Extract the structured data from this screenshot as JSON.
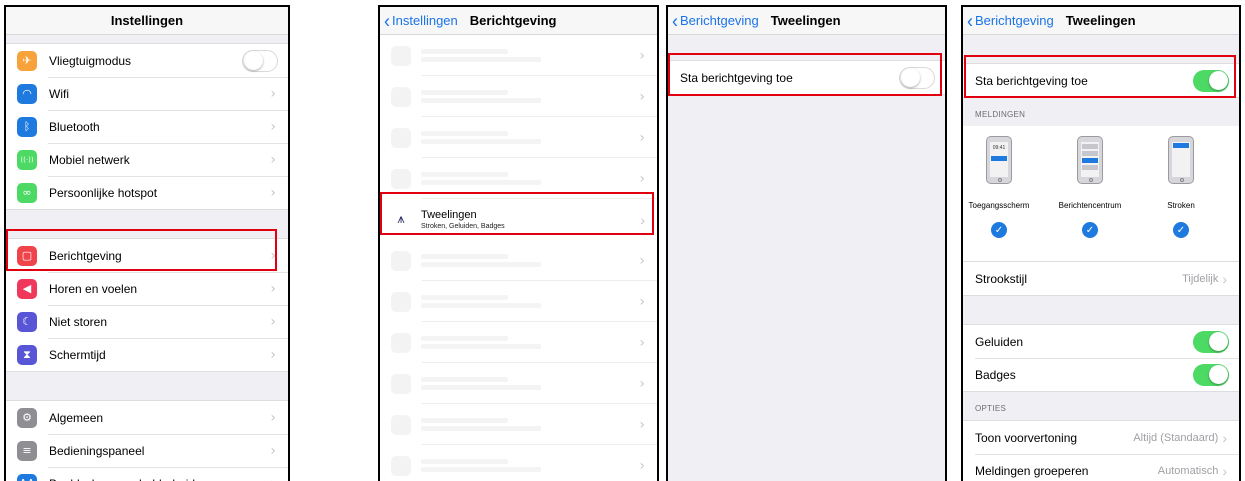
{
  "panel1": {
    "title": "Instellingen",
    "group1": [
      {
        "label": "Vliegtuigmodus",
        "icon": "airplane-icon",
        "color": "#f7a23b",
        "glyph": "✈",
        "control": "toggle-off"
      },
      {
        "label": "Wifi",
        "icon": "wifi-icon",
        "color": "#1f7ae0",
        "glyph": "◠"
      },
      {
        "label": "Bluetooth",
        "icon": "bluetooth-icon",
        "color": "#1f7ae0",
        "glyph": "ᛒ"
      },
      {
        "label": "Mobiel netwerk",
        "icon": "cellular-icon",
        "color": "#4cd964",
        "glyph": "((·))"
      },
      {
        "label": "Persoonlijke hotspot",
        "icon": "hotspot-icon",
        "color": "#4cd964",
        "glyph": "∞"
      }
    ],
    "group2": [
      {
        "label": "Berichtgeving",
        "icon": "notifications-icon",
        "color": "#f0444b",
        "glyph": "▢"
      },
      {
        "label": "Horen en voelen",
        "icon": "sounds-icon",
        "color": "#f0375c",
        "glyph": "◀"
      },
      {
        "label": "Niet storen",
        "icon": "moon-icon",
        "color": "#5856d6",
        "glyph": "☾"
      },
      {
        "label": "Schermtijd",
        "icon": "hourglass-icon",
        "color": "#5856d6",
        "glyph": "⧗"
      }
    ],
    "group3": [
      {
        "label": "Algemeen",
        "icon": "gear-icon",
        "color": "#8e8e93",
        "glyph": "⚙"
      },
      {
        "label": "Bedieningspaneel",
        "icon": "control-center-icon",
        "color": "#8e8e93",
        "glyph": "≡"
      },
      {
        "label": "Beeldscherm en helderheid",
        "icon": "display-icon",
        "color": "#1f7ae0",
        "glyph": "AA"
      }
    ]
  },
  "panel2": {
    "back": "Instellingen",
    "title": "Berichtgeving",
    "app_title": "Tweelingen",
    "app_subtitle": "Stroken, Geluiden, Badges"
  },
  "panel3": {
    "back": "Berichtgeving",
    "title": "Tweelingen",
    "allow_label": "Sta berichtgeving toe"
  },
  "panel4": {
    "back": "Berichtgeving",
    "title": "Tweelingen",
    "allow_label": "Sta berichtgeving toe",
    "meldingen_header": "MELDINGEN",
    "phone_time": "09:41",
    "alert_styles": [
      "Toegangsscherm",
      "Berichtencentrum",
      "Stroken"
    ],
    "strookstijl_label": "Strookstijl",
    "strookstijl_value": "Tijdelijk",
    "geluiden_label": "Geluiden",
    "badges_label": "Badges",
    "opties_header": "OPTIES",
    "toon_label": "Toon voorvertoning",
    "toon_value": "Altijd (Standaard)",
    "groeperen_label": "Meldingen groeperen",
    "groeperen_value": "Automatisch"
  },
  "colors": {
    "accent": "#1f7ae0",
    "toggle_on": "#4cd964",
    "highlight": "#e10010"
  }
}
